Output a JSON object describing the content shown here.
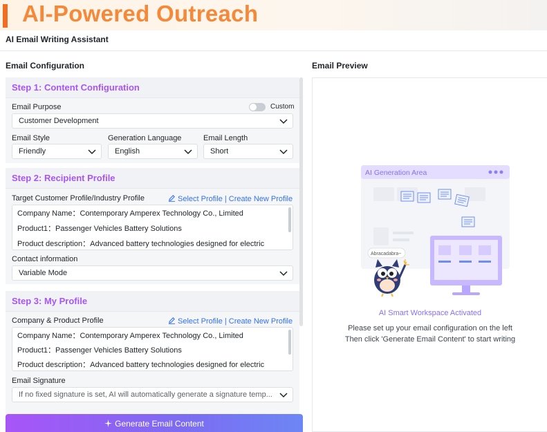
{
  "banner": {
    "title": "AI-Powered Outreach"
  },
  "app": {
    "title": "AI Email Writing Assistant"
  },
  "config": {
    "section_title": "Email Configuration",
    "step1": {
      "title": "Step 1: Content Configuration",
      "purpose_label": "Email Purpose",
      "custom_label": "Custom",
      "purpose_value": "Customer Development",
      "style_label": "Email Style",
      "style_value": "Friendly",
      "language_label": "Generation Language",
      "language_value": "English",
      "length_label": "Email Length",
      "length_value": "Short"
    },
    "step2": {
      "title": "Step 2: Recipient Profile",
      "target_label": "Target Customer Profile/Industry Profile",
      "select_link": "Select Profile | Create New Profile",
      "lines": [
        "Company Name：Contemporary Amperex Technology Co., Limited",
        "Product1：Passenger Vehicles Battery Solutions",
        "Product description：Advanced battery technologies designed for electric"
      ],
      "contact_label": "Contact information",
      "contact_value": "Variable Mode"
    },
    "step3": {
      "title": "Step 3: My Profile",
      "profile_label": "Company & Product Profile",
      "select_link": "Select Profile | Create New Profile",
      "lines": [
        "Company Name：Contemporary Amperex Technology Co., Limited",
        "Product1：Passenger Vehicles Battery Solutions",
        "Product description：Advanced battery technologies designed for electric"
      ],
      "signature_label": "Email Signature",
      "signature_placeholder": "If no fixed signature is set, AI will automatically generate a signature temp..."
    },
    "generate_button": "Generate Email Content"
  },
  "preview": {
    "section_title": "Email Preview",
    "area_label": "AI Generation Area",
    "bubble_text": "Abracadabra~",
    "activated": "AI Smart Workspace Activated",
    "instruction1": "Please set up your email configuration on the left",
    "instruction2": "Then click 'Generate Email Content' to start writing"
  },
  "colors": {
    "accent_purple": "#a855f7",
    "link_blue": "#3370ff",
    "banner_orange": "#f5893a"
  }
}
